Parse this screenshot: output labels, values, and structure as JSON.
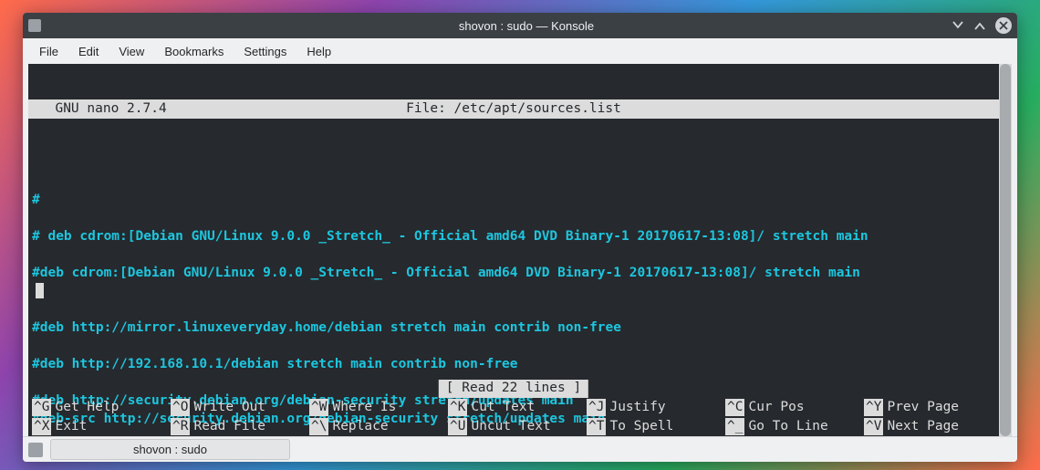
{
  "window": {
    "title": "shovon : sudo — Konsole"
  },
  "menubar": {
    "items": [
      "File",
      "Edit",
      "View",
      "Bookmarks",
      "Settings",
      "Help"
    ]
  },
  "nano": {
    "version_label": "  GNU nano 2.7.4",
    "file_label": "File: /etc/apt/sources.list",
    "status": "[ Read 22 lines ]",
    "lines": [
      "#",
      "",
      "# deb cdrom:[Debian GNU/Linux 9.0.0 _Stretch_ - Official amd64 DVD Binary-1 20170617-13:08]/ stretch main",
      "",
      "#deb cdrom:[Debian GNU/Linux 9.0.0 _Stretch_ - Official amd64 DVD Binary-1 20170617-13:08]/ stretch main",
      "__CURSOR__",
      "",
      "#deb http://mirror.linuxeveryday.home/debian stretch main contrib non-free",
      "",
      "#deb http://192.168.10.1/debian stretch main contrib non-free",
      "",
      "#deb http://security.debian.org/debian-security stretch/updates main",
      "#deb-src http://security.debian.org/debian-security stretch/updates main"
    ],
    "footer": [
      {
        "key": "^G",
        "label": "Get Help"
      },
      {
        "key": "^O",
        "label": "Write Out"
      },
      {
        "key": "^W",
        "label": "Where Is"
      },
      {
        "key": "^K",
        "label": "Cut Text"
      },
      {
        "key": "^J",
        "label": "Justify"
      },
      {
        "key": "^C",
        "label": "Cur Pos"
      },
      {
        "key": "^X",
        "label": "Exit"
      },
      {
        "key": "^R",
        "label": "Read File"
      },
      {
        "key": "^\\",
        "label": "Replace"
      },
      {
        "key": "^U",
        "label": "Uncut Text"
      },
      {
        "key": "^T",
        "label": "To Spell"
      },
      {
        "key": "^_",
        "label": "Go To Line"
      }
    ],
    "footer_extra": [
      {
        "key": "^Y",
        "label": "Prev Page"
      },
      {
        "key": "^V",
        "label": "Next Page"
      }
    ]
  },
  "tabbar": {
    "tab_label": "shovon : sudo"
  }
}
